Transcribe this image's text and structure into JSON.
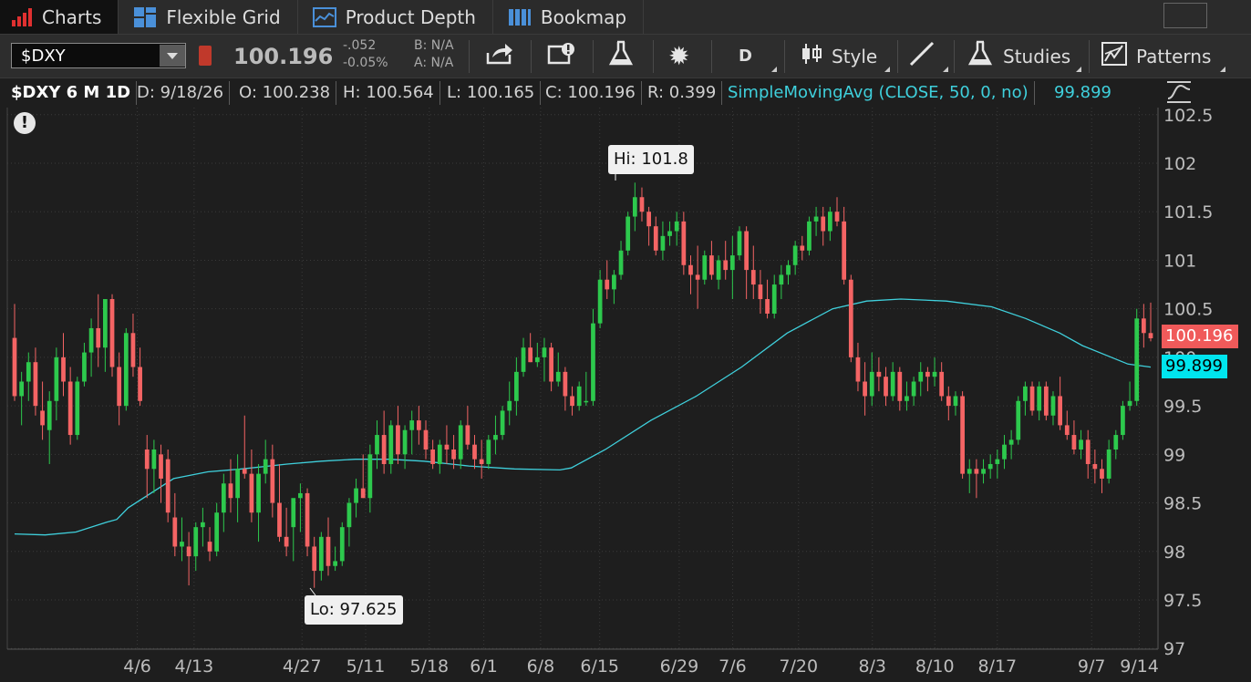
{
  "tabs": [
    {
      "label": "Charts",
      "icon": "bar-chart-icon",
      "active": true
    },
    {
      "label": "Flexible Grid",
      "icon": "grid-icon",
      "active": false
    },
    {
      "label": "Product Depth",
      "icon": "depth-icon",
      "active": false
    },
    {
      "label": "Bookmap",
      "icon": "bookmap-icon",
      "active": false
    }
  ],
  "toolbar": {
    "symbol": "$DXY",
    "last_price": "100.196",
    "net_change": "-.052",
    "pct_change": "-0.05%",
    "bid": "B: N/A",
    "ask": "A: N/A",
    "aggregation": "D",
    "style_label": "Style",
    "studies_label": "Studies",
    "patterns_label": "Patterns"
  },
  "info_bar": {
    "symbol_period": "$DXY 6 M 1D",
    "date": "D: 9/18/26",
    "open": "O: 100.238",
    "high": "H: 100.564",
    "low": "L: 100.165",
    "close": "C: 100.196",
    "range": "R: 0.399",
    "study": "SimpleMovingAvg (CLOSE, 50, 0, no)",
    "study_value": "99.899"
  },
  "colors": {
    "up": "#2dc94d",
    "down": "#f46464",
    "sma": "#3fd0dc",
    "price_tag": "#f05a5a",
    "sma_tag": "#00e5ee",
    "background": "#1e1e1e"
  },
  "chart_data": {
    "type": "candlestick",
    "y_ticks": [
      "102.5",
      "102",
      "101.5",
      "101",
      "100.5",
      "100",
      "99.5",
      "99",
      "98.5",
      "98",
      "97.5",
      "97"
    ],
    "ylim": [
      97,
      102.5
    ],
    "x_tick_labels": [
      "4/6",
      "4/13",
      "4/27",
      "5/11",
      "5/18",
      "6/1",
      "6/8",
      "6/15",
      "6/29",
      "7/6",
      "7/20",
      "8/3",
      "8/10",
      "8/17",
      "9/7",
      "9/14"
    ],
    "high_callout": "Hi: 101.8",
    "low_callout": "Lo: 97.625",
    "last_price_tag": "100.196",
    "sma_tag": "99.899",
    "candles": [
      [
        100.2,
        100.55,
        99.55,
        99.6
      ],
      [
        99.6,
        99.85,
        99.3,
        99.75
      ],
      [
        99.75,
        100.05,
        99.55,
        99.95
      ],
      [
        99.95,
        100.1,
        99.4,
        99.5
      ],
      [
        99.45,
        99.75,
        99.15,
        99.3
      ],
      [
        99.25,
        99.65,
        98.9,
        99.55
      ],
      [
        99.55,
        100.1,
        99.35,
        100.0
      ],
      [
        100.0,
        100.25,
        99.6,
        99.75
      ],
      [
        99.75,
        99.9,
        99.1,
        99.2
      ],
      [
        99.2,
        99.8,
        99.15,
        99.75
      ],
      [
        99.75,
        100.15,
        99.7,
        100.05
      ],
      [
        100.05,
        100.4,
        99.8,
        100.3
      ],
      [
        100.3,
        100.65,
        99.9,
        100.1
      ],
      [
        100.1,
        100.6,
        99.85,
        100.6
      ],
      [
        100.6,
        100.65,
        99.8,
        99.9
      ],
      [
        99.9,
        100.05,
        99.3,
        99.5
      ],
      [
        99.5,
        100.3,
        99.45,
        100.25
      ],
      [
        100.25,
        100.45,
        99.8,
        99.9
      ],
      [
        99.9,
        100.1,
        99.5,
        99.55
      ],
      [
        99.05,
        99.2,
        98.55,
        98.85
      ],
      [
        98.85,
        99.15,
        98.6,
        99.05
      ],
      [
        99.0,
        99.1,
        98.5,
        98.75
      ],
      [
        98.95,
        99.05,
        98.3,
        98.4
      ],
      [
        98.35,
        98.6,
        97.95,
        98.05
      ],
      [
        98.05,
        98.35,
        97.9,
        98.1
      ],
      [
        98.05,
        98.2,
        97.65,
        97.95
      ],
      [
        97.95,
        98.3,
        97.8,
        98.25
      ],
      [
        98.25,
        98.45,
        98.05,
        98.3
      ],
      [
        98.1,
        98.25,
        97.9,
        98.0
      ],
      [
        98.0,
        98.5,
        97.95,
        98.4
      ],
      [
        98.4,
        98.8,
        98.2,
        98.7
      ],
      [
        98.7,
        98.95,
        98.4,
        98.55
      ],
      [
        98.55,
        99.0,
        98.3,
        98.85
      ],
      [
        98.85,
        99.4,
        98.75,
        98.8
      ],
      [
        98.8,
        99.05,
        98.3,
        98.4
      ],
      [
        98.4,
        98.9,
        98.1,
        98.8
      ],
      [
        98.8,
        99.15,
        98.7,
        98.95
      ],
      [
        98.95,
        99.1,
        98.35,
        98.5
      ],
      [
        98.5,
        98.9,
        98.1,
        98.15
      ],
      [
        98.15,
        98.45,
        97.95,
        98.05
      ],
      [
        98.25,
        98.5,
        97.9,
        98.55
      ],
      [
        98.55,
        98.7,
        98.2,
        98.6
      ],
      [
        98.6,
        98.65,
        97.95,
        98.05
      ],
      [
        98.05,
        98.15,
        97.625,
        97.8
      ],
      [
        97.8,
        98.2,
        97.7,
        98.15
      ],
      [
        98.15,
        98.35,
        97.75,
        97.85
      ],
      [
        97.85,
        98.05,
        97.8,
        97.9
      ],
      [
        97.9,
        98.3,
        97.85,
        98.25
      ],
      [
        98.25,
        98.55,
        98.05,
        98.5
      ],
      [
        98.5,
        98.75,
        98.35,
        98.65
      ],
      [
        98.65,
        99.0,
        98.55,
        98.55
      ],
      [
        98.55,
        99.1,
        98.4,
        99.0
      ],
      [
        99.0,
        99.35,
        98.85,
        99.2
      ],
      [
        99.2,
        99.45,
        98.8,
        98.9
      ],
      [
        98.9,
        99.35,
        98.8,
        99.3
      ],
      [
        99.3,
        99.5,
        98.9,
        99.0
      ],
      [
        99.0,
        99.3,
        98.85,
        99.25
      ],
      [
        99.25,
        99.45,
        99.0,
        99.35
      ],
      [
        99.35,
        99.5,
        99.1,
        99.25
      ],
      [
        99.25,
        99.35,
        98.95,
        99.05
      ],
      [
        99.05,
        99.15,
        98.85,
        98.9
      ],
      [
        98.9,
        99.15,
        98.8,
        99.1
      ],
      [
        99.1,
        99.3,
        98.9,
        99.05
      ],
      [
        99.05,
        99.2,
        98.85,
        98.95
      ],
      [
        98.95,
        99.35,
        98.85,
        99.3
      ],
      [
        99.3,
        99.5,
        99.05,
        99.1
      ],
      [
        99.1,
        99.2,
        98.85,
        98.95
      ],
      [
        98.95,
        99.15,
        98.75,
        98.9
      ],
      [
        98.9,
        99.2,
        98.85,
        99.15
      ],
      [
        99.15,
        99.4,
        99.0,
        99.2
      ],
      [
        99.2,
        99.5,
        99.15,
        99.45
      ],
      [
        99.45,
        99.75,
        99.3,
        99.55
      ],
      [
        99.55,
        100.0,
        99.4,
        99.85
      ],
      [
        99.85,
        100.2,
        99.8,
        100.1
      ],
      [
        100.1,
        100.25,
        99.95,
        99.95
      ],
      [
        99.95,
        100.15,
        99.9,
        100.0
      ],
      [
        100.0,
        100.2,
        99.75,
        100.1
      ],
      [
        100.1,
        100.15,
        99.65,
        99.75
      ],
      [
        99.75,
        100.05,
        99.7,
        99.85
      ],
      [
        99.85,
        99.9,
        99.45,
        99.6
      ],
      [
        99.6,
        99.7,
        99.4,
        99.5
      ],
      [
        99.5,
        99.75,
        99.45,
        99.7
      ],
      [
        99.55,
        99.85,
        99.5,
        99.55
      ],
      [
        99.55,
        100.5,
        99.5,
        100.35
      ],
      [
        100.35,
        100.9,
        100.3,
        100.8
      ],
      [
        100.8,
        101.0,
        100.6,
        100.7
      ],
      [
        100.7,
        100.9,
        100.55,
        100.85
      ],
      [
        100.85,
        101.2,
        100.8,
        101.1
      ],
      [
        101.1,
        101.5,
        101.05,
        101.45
      ],
      [
        101.45,
        101.8,
        101.3,
        101.65
      ],
      [
        101.65,
        101.75,
        101.4,
        101.5
      ],
      [
        101.5,
        101.55,
        101.15,
        101.35
      ],
      [
        101.35,
        101.45,
        101.05,
        101.1
      ],
      [
        101.1,
        101.4,
        101.0,
        101.25
      ],
      [
        101.25,
        101.4,
        101.15,
        101.3
      ],
      [
        101.3,
        101.5,
        101.15,
        101.4
      ],
      [
        101.4,
        101.5,
        100.85,
        100.95
      ],
      [
        100.95,
        101.05,
        100.65,
        100.85
      ],
      [
        100.85,
        101.15,
        100.5,
        100.8
      ],
      [
        100.8,
        101.1,
        100.75,
        101.05
      ],
      [
        101.05,
        101.2,
        100.8,
        100.85
      ],
      [
        100.8,
        101.05,
        100.7,
        101.0
      ],
      [
        101.0,
        101.2,
        100.8,
        100.9
      ],
      [
        100.9,
        101.25,
        100.6,
        101.05
      ],
      [
        101.05,
        101.35,
        101.0,
        101.3
      ],
      [
        101.3,
        101.35,
        100.6,
        100.9
      ],
      [
        100.9,
        101.15,
        100.6,
        100.75
      ],
      [
        100.75,
        100.9,
        100.45,
        100.6
      ],
      [
        100.6,
        100.8,
        100.4,
        100.45
      ],
      [
        100.45,
        100.85,
        100.4,
        100.75
      ],
      [
        100.75,
        100.95,
        100.6,
        100.85
      ],
      [
        100.85,
        101.0,
        100.75,
        100.95
      ],
      [
        100.95,
        101.2,
        100.85,
        101.15
      ],
      [
        101.15,
        101.25,
        101.0,
        101.1
      ],
      [
        101.1,
        101.45,
        101.05,
        101.4
      ],
      [
        101.4,
        101.55,
        101.25,
        101.45
      ],
      [
        101.45,
        101.55,
        101.15,
        101.3
      ],
      [
        101.3,
        101.55,
        101.2,
        101.5
      ],
      [
        101.5,
        101.65,
        101.35,
        101.4
      ],
      [
        101.4,
        101.55,
        100.75,
        100.8
      ],
      [
        100.8,
        100.85,
        99.95,
        100.0
      ],
      [
        100.0,
        100.15,
        99.65,
        99.75
      ],
      [
        99.75,
        99.95,
        99.4,
        99.6
      ],
      [
        99.6,
        100.05,
        99.5,
        99.85
      ],
      [
        99.85,
        100.0,
        99.65,
        99.8
      ],
      [
        99.8,
        99.9,
        99.5,
        99.6
      ],
      [
        99.6,
        99.95,
        99.55,
        99.85
      ],
      [
        99.85,
        99.9,
        99.45,
        99.55
      ],
      [
        99.55,
        99.75,
        99.45,
        99.6
      ],
      [
        99.6,
        99.8,
        99.5,
        99.75
      ],
      [
        99.75,
        99.95,
        99.6,
        99.85
      ],
      [
        99.85,
        99.9,
        99.65,
        99.8
      ],
      [
        99.8,
        100.0,
        99.7,
        99.85
      ],
      [
        99.85,
        99.95,
        99.55,
        99.6
      ],
      [
        99.6,
        99.7,
        99.35,
        99.5
      ],
      [
        99.5,
        99.65,
        99.4,
        99.6
      ],
      [
        99.6,
        99.65,
        98.75,
        98.8
      ],
      [
        98.8,
        98.95,
        98.6,
        98.85
      ],
      [
        98.85,
        98.95,
        98.55,
        98.8
      ],
      [
        98.8,
        98.95,
        98.7,
        98.85
      ],
      [
        98.85,
        99.0,
        98.75,
        98.9
      ],
      [
        98.9,
        99.05,
        98.75,
        98.95
      ],
      [
        98.95,
        99.2,
        98.85,
        99.1
      ],
      [
        99.1,
        99.25,
        98.95,
        99.15
      ],
      [
        99.15,
        99.6,
        99.1,
        99.55
      ],
      [
        99.55,
        99.75,
        99.4,
        99.7
      ],
      [
        99.7,
        99.75,
        99.4,
        99.45
      ],
      [
        99.45,
        99.75,
        99.35,
        99.7
      ],
      [
        99.7,
        99.75,
        99.35,
        99.4
      ],
      [
        99.4,
        99.65,
        99.3,
        99.6
      ],
      [
        99.6,
        99.8,
        99.25,
        99.3
      ],
      [
        99.3,
        99.45,
        99.15,
        99.2
      ],
      [
        99.2,
        99.35,
        99.0,
        99.05
      ],
      [
        99.05,
        99.25,
        98.95,
        99.15
      ],
      [
        99.15,
        99.25,
        98.75,
        98.9
      ],
      [
        98.9,
        99.05,
        98.7,
        98.85
      ],
      [
        98.85,
        98.95,
        98.6,
        98.75
      ],
      [
        98.75,
        99.15,
        98.7,
        99.05
      ],
      [
        99.05,
        99.25,
        98.95,
        99.2
      ],
      [
        99.2,
        99.55,
        99.15,
        99.5
      ],
      [
        99.5,
        99.75,
        99.45,
        99.55
      ],
      [
        99.55,
        100.5,
        99.5,
        100.4
      ],
      [
        100.4,
        100.55,
        100.1,
        100.25
      ],
      [
        100.25,
        100.564,
        100.165,
        100.196
      ]
    ],
    "sma": [
      [
        0,
        98.18
      ],
      [
        0.027,
        98.17
      ],
      [
        0.054,
        98.2
      ],
      [
        0.081,
        98.3
      ],
      [
        0.09,
        98.33
      ],
      [
        0.1,
        98.45
      ],
      [
        0.14,
        98.75
      ],
      [
        0.17,
        98.82
      ],
      [
        0.2,
        98.85
      ],
      [
        0.24,
        98.9
      ],
      [
        0.27,
        98.93
      ],
      [
        0.3,
        98.95
      ],
      [
        0.33,
        98.95
      ],
      [
        0.36,
        98.93
      ],
      [
        0.4,
        98.88
      ],
      [
        0.44,
        98.85
      ],
      [
        0.48,
        98.84
      ],
      [
        0.49,
        98.86
      ],
      [
        0.52,
        99.05
      ],
      [
        0.56,
        99.35
      ],
      [
        0.6,
        99.6
      ],
      [
        0.64,
        99.9
      ],
      [
        0.68,
        100.25
      ],
      [
        0.72,
        100.5
      ],
      [
        0.75,
        100.58
      ],
      [
        0.78,
        100.6
      ],
      [
        0.82,
        100.58
      ],
      [
        0.86,
        100.52
      ],
      [
        0.89,
        100.4
      ],
      [
        0.92,
        100.25
      ],
      [
        0.94,
        100.12
      ],
      [
        0.98,
        99.93
      ],
      [
        1.0,
        99.899
      ]
    ]
  }
}
